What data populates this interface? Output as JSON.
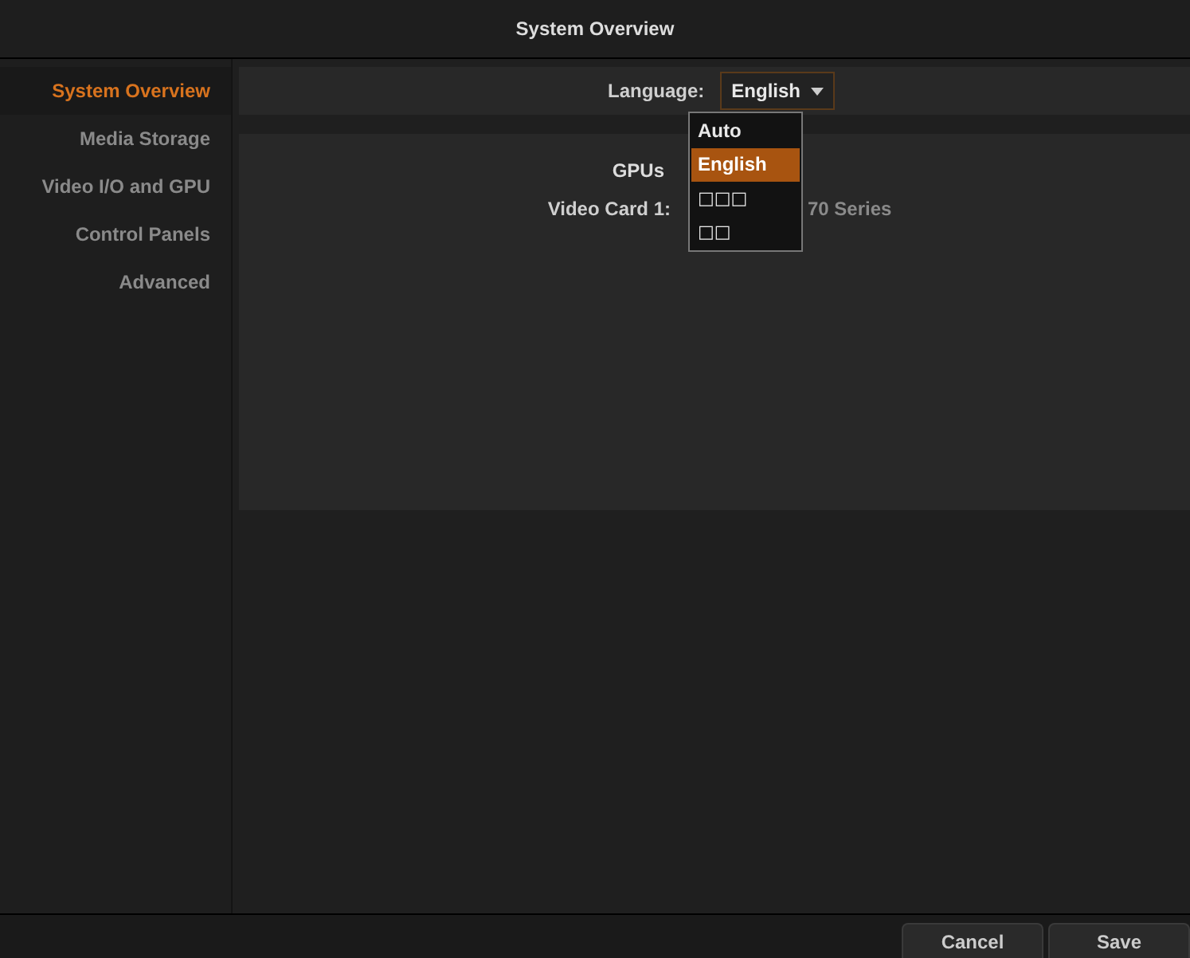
{
  "window": {
    "title": "System Overview"
  },
  "sidebar": {
    "items": [
      {
        "label": "System Overview",
        "selected": true
      },
      {
        "label": "Media Storage",
        "selected": false
      },
      {
        "label": "Video I/O and GPU",
        "selected": false
      },
      {
        "label": "Control Panels",
        "selected": false
      },
      {
        "label": "Advanced",
        "selected": false
      }
    ]
  },
  "language": {
    "label": "Language:",
    "value": "English",
    "expanded": true,
    "options": [
      {
        "label": "Auto",
        "selected": false
      },
      {
        "label": "English",
        "selected": true
      },
      {
        "label": "□□□",
        "selected": false
      },
      {
        "label": "□□",
        "selected": false
      }
    ]
  },
  "gpus": {
    "heading": "GPUs",
    "rows": [
      {
        "label": "Video Card 1:",
        "value": "70 Series"
      }
    ]
  },
  "buttons": [
    "Cancel",
    "Save"
  ]
}
